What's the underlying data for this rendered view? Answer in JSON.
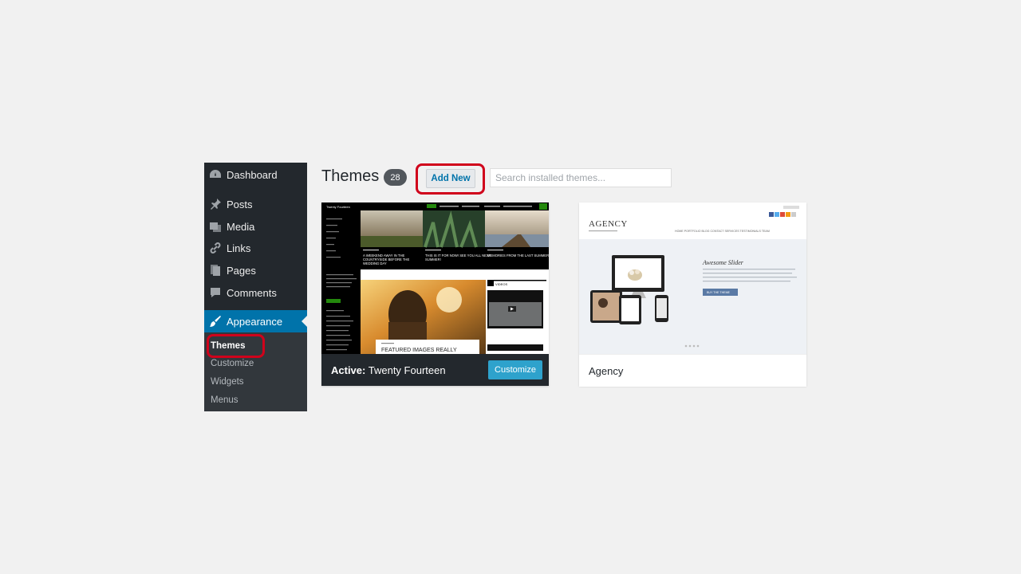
{
  "sidebar": {
    "items": [
      {
        "label": "Dashboard",
        "icon": "dashboard-icon"
      },
      {
        "label": "Posts",
        "icon": "pin-icon"
      },
      {
        "label": "Media",
        "icon": "media-icon"
      },
      {
        "label": "Links",
        "icon": "link-icon"
      },
      {
        "label": "Pages",
        "icon": "pages-icon"
      },
      {
        "label": "Comments",
        "icon": "comment-icon"
      },
      {
        "label": "Appearance",
        "icon": "brush-icon"
      }
    ],
    "submenu": [
      "Themes",
      "Customize",
      "Widgets",
      "Menus"
    ]
  },
  "header": {
    "title": "Themes",
    "count": "28",
    "add_new": "Add New",
    "search_placeholder": "Search installed themes..."
  },
  "themes": [
    {
      "active_prefix": "Active:",
      "name": "Twenty Fourteen",
      "customize": "Customize"
    },
    {
      "name": "Agency"
    }
  ],
  "preview_tf": {
    "site_title": "Twenty Fourteen",
    "post1": "A WEEKEND AWAY IN THE COUNTRYSIDE BEFORE THE WEDDING DAY",
    "post2": "THIS IS IT FOR NOW! SEE YOU ALL NEXT SUMMER!",
    "post3": "MEMORIES FROM THE LAST SUMMER",
    "featured": "FEATURED IMAGES REALLY",
    "videos": "VIDEOS"
  },
  "preview_agency": {
    "logo": "AGENCY",
    "slider_title": "Awesome Slider",
    "nav": [
      "HOME",
      "PORTFOLIO",
      "BLOG",
      "CONTACT",
      "SERVICES",
      "TESTIMONIALS",
      "TEAM"
    ],
    "button": "BUY THE THEME"
  },
  "colors": {
    "accent": "#0073aa",
    "highlight": "#d0021b",
    "sidebar": "#23282d"
  }
}
